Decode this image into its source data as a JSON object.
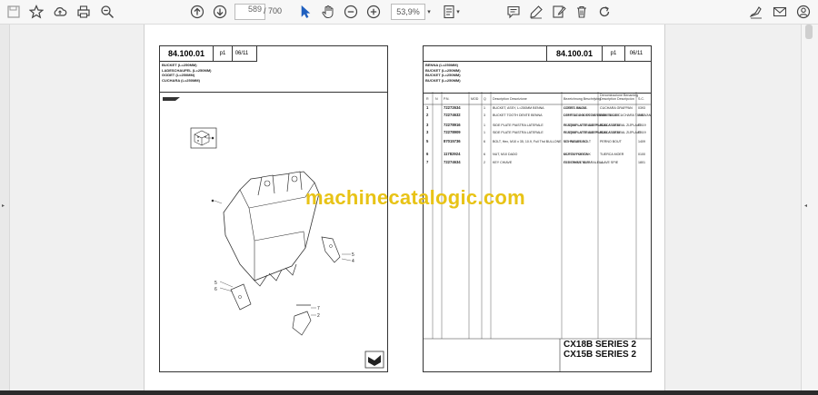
{
  "toolbar": {
    "current_page": "589",
    "total_pages": "/ 700",
    "zoom": "53,9%",
    "icons": [
      "save-icon",
      "bookmark-icon",
      "upload-icon",
      "print-icon",
      "zoom-out-icon",
      "previous-page-icon",
      "next-page-icon",
      "select-tool-icon",
      "hand-tool-icon",
      "zoom-in-icon",
      "page-fit-icon",
      "comment-icon",
      "draw-icon",
      "edit-icon",
      "delete-icon",
      "rotate-icon",
      "sign-icon",
      "email-icon",
      "account-icon"
    ]
  },
  "left_page": {
    "code": "84.100.01",
    "page": "p1",
    "date": "06/11",
    "titles": [
      "BUCKET (L=250MM)",
      "LADESCHAUFEL (L=250MM)",
      "GODET (L=250MM)",
      "CUCHARA (L=250MM)"
    ],
    "callouts": [
      "1",
      "2",
      "3",
      "4",
      "5",
      "6",
      "7"
    ]
  },
  "right_page": {
    "code": "84.100.01",
    "page": "p1",
    "date": "06/11",
    "titles": [
      "BENNA (L=250MM)",
      "BUCKET (L=250MM)",
      "BUCKET (L=250MM)",
      "BUCKET (L=250MM)"
    ],
    "columns": [
      "R",
      "N",
      "P.N.",
      "MOD",
      "Q",
      "Description Descrizione",
      "Bezeichnung Beschrijving",
      "Description Descripción",
      "Denominazione Benaming",
      "S.C."
    ],
    "rows": [
      {
        "ref": "1",
        "pn": "72272634",
        "q": "1",
        "en": "BUCKET, ASSY, L=250MM BENNA",
        "de": "LOFFEL SKOVL",
        "fr": "GODET BALDE",
        "it": "CUCHARA GRAFPAN",
        "sc": "0393"
      },
      {
        "ref": "2",
        "pn": "72274632",
        "q": "3",
        "en": "BUCKET TOOTH DENTE BENNA",
        "de": "LOFFELZAHN SKOVLTAND",
        "fr": "DENT DE GODET DENTE DE BALDE",
        "it": "DIENTE DE CUCHARA TAND VAN BAK",
        "sc": "0082"
      },
      {
        "ref": "3",
        "pn": "72278916",
        "q": "1",
        "en": "SIDE PLATE PIASTRA LATERALE",
        "de": "SEITENPLATTE SIDEPLADE",
        "fr": "PLAQUE LATERALE PLACA LATERAL",
        "it": "PLACA LATERAL ZIJPLAAT",
        "sc": "R419"
      },
      {
        "ref": "3",
        "pn": "72278909",
        "q": "1",
        "en": "SIDE PLATE PIASTRA LATERALE",
        "de": "SEITENPLATTE SIDEPLADE",
        "fr": "PLAQUE LATERALE PLACA LATERAL",
        "it": "PLACA LATERAL ZIJPLAAT",
        "sc": "R419"
      },
      {
        "ref": "5",
        "pn": "87015736",
        "q": "6",
        "en": "BOLT, Hex, M10 x 35, 10.9, Full Thd BULLONE",
        "de": "SCHRAUBE BOLT",
        "fr": "VIS PARAFUSO",
        "it": "PERNO BOUT",
        "sc": "1409"
      },
      {
        "ref": "6",
        "pn": "11782924",
        "q": "6",
        "en": "NUT, M10 DADO",
        "de": "MUTTER MOTRIK",
        "fr": "ECROU PORCA",
        "it": "TUERCA MOER",
        "sc": "0100"
      },
      {
        "ref": "7",
        "pn": "72274634",
        "q": "2",
        "en": "KEY CHIAVE",
        "de": "FEDERKEIL KILE",
        "fr": "CLE CHAVETA PARALELA",
        "it": "LLAVE SPIE",
        "sc": "1801"
      }
    ],
    "series": [
      "CX18B SERIES 2",
      "CX15B SERIES 2"
    ]
  },
  "watermark": "machinecatalogic.com"
}
